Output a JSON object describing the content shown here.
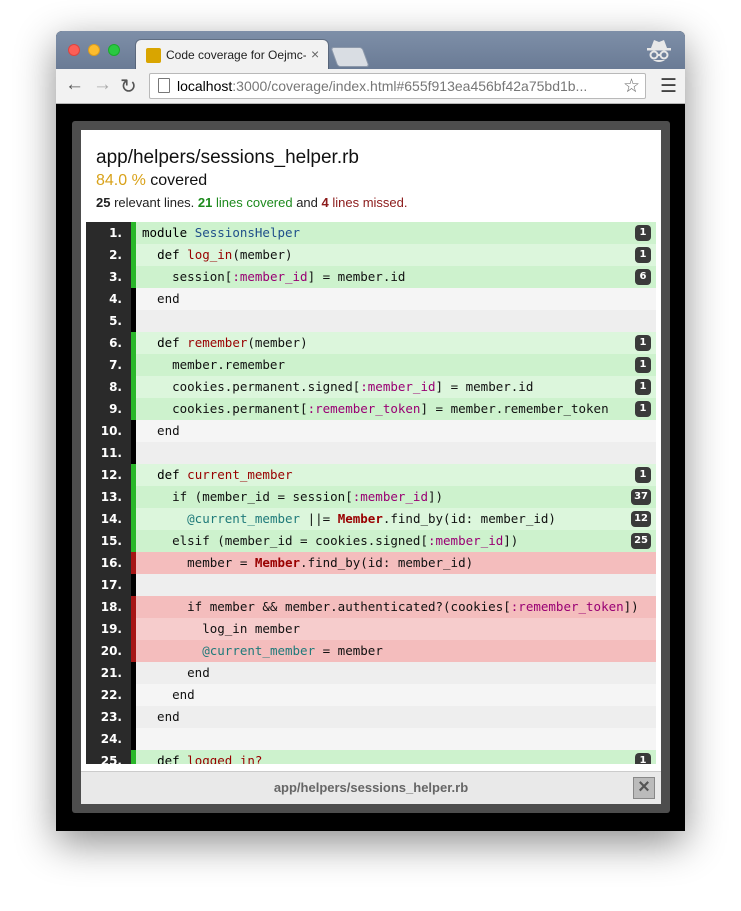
{
  "browser": {
    "tab_title": "Code coverage for Oejmc-",
    "tab_close_icon": "close-icon",
    "url_host": "localhost",
    "url_rest": ":3000/coverage/index.html#655f913ea456bf42a75bd1b..."
  },
  "report": {
    "file_path": "app/helpers/sessions_helper.rb",
    "percent": "84.0 %",
    "covered_word": " covered",
    "relevant_count": "25",
    "relevant_text": " relevant lines. ",
    "covered_count": "21",
    "covered_text": " lines covered",
    "and_text": " and ",
    "missed_count": "4",
    "missed_text": " lines missed."
  },
  "colors": {
    "covered_bar": "#2ab72a",
    "missed_bar": "#a61515",
    "percent": "#d9a21a"
  },
  "lines": [
    {
      "num": "1.",
      "status": "covered",
      "hits": "1",
      "code": [
        [
          "kw",
          "module "
        ],
        [
          "const",
          "SessionsHelper"
        ]
      ]
    },
    {
      "num": "2.",
      "status": "covered",
      "hits": "1",
      "code": [
        [
          "",
          "  "
        ],
        [
          "kw",
          "def "
        ],
        [
          "meth",
          "log_in"
        ],
        [
          "",
          "(member)"
        ]
      ]
    },
    {
      "num": "3.",
      "status": "covered",
      "hits": "6",
      "code": [
        [
          "",
          "    session["
        ],
        [
          "sym",
          ":member_id"
        ],
        [
          "",
          "] = member.id"
        ]
      ]
    },
    {
      "num": "4.",
      "status": "never",
      "hits": "",
      "code": [
        [
          "",
          "  end"
        ]
      ]
    },
    {
      "num": "5.",
      "status": "never",
      "hits": "",
      "code": [
        [
          "",
          ""
        ]
      ]
    },
    {
      "num": "6.",
      "status": "covered",
      "hits": "1",
      "code": [
        [
          "",
          "  "
        ],
        [
          "kw",
          "def "
        ],
        [
          "meth",
          "remember"
        ],
        [
          "",
          "(member)"
        ]
      ]
    },
    {
      "num": "7.",
      "status": "covered",
      "hits": "1",
      "code": [
        [
          "",
          "    member.remember"
        ]
      ]
    },
    {
      "num": "8.",
      "status": "covered",
      "hits": "1",
      "code": [
        [
          "",
          "    cookies.permanent.signed["
        ],
        [
          "sym",
          ":member_id"
        ],
        [
          "",
          "] = member.id"
        ]
      ]
    },
    {
      "num": "9.",
      "status": "covered",
      "hits": "1",
      "code": [
        [
          "",
          "    cookies.permanent["
        ],
        [
          "sym",
          ":remember_token"
        ],
        [
          "",
          "] = member.remember_token"
        ]
      ]
    },
    {
      "num": "10.",
      "status": "never",
      "hits": "",
      "code": [
        [
          "",
          "  end"
        ]
      ]
    },
    {
      "num": "11.",
      "status": "never",
      "hits": "",
      "code": [
        [
          "",
          ""
        ]
      ]
    },
    {
      "num": "12.",
      "status": "covered",
      "hits": "1",
      "code": [
        [
          "",
          "  "
        ],
        [
          "kw",
          "def "
        ],
        [
          "meth",
          "current_member"
        ]
      ]
    },
    {
      "num": "13.",
      "status": "covered",
      "hits": "37",
      "code": [
        [
          "",
          "    if (member_id = session["
        ],
        [
          "sym",
          ":member_id"
        ],
        [
          "",
          "])"
        ]
      ]
    },
    {
      "num": "14.",
      "status": "covered",
      "hits": "12",
      "code": [
        [
          "",
          "      "
        ],
        [
          "ivar",
          "@current_member"
        ],
        [
          "",
          " ||= "
        ],
        [
          "cls",
          "Member"
        ],
        [
          "",
          ".find_by(id: member_id)"
        ]
      ]
    },
    {
      "num": "15.",
      "status": "covered",
      "hits": "25",
      "code": [
        [
          "",
          "    elsif (member_id = cookies.signed["
        ],
        [
          "sym",
          ":member_id"
        ],
        [
          "",
          "])"
        ]
      ]
    },
    {
      "num": "16.",
      "status": "missed",
      "hits": "",
      "code": [
        [
          "",
          "      member = "
        ],
        [
          "cls",
          "Member"
        ],
        [
          "",
          ".find_by(id: member_id)"
        ]
      ]
    },
    {
      "num": "17.",
      "status": "never",
      "hits": "",
      "code": [
        [
          "",
          ""
        ]
      ]
    },
    {
      "num": "18.",
      "status": "missed",
      "hits": "",
      "code": [
        [
          "",
          "      if member && member.authenticated?(cookies["
        ],
        [
          "sym",
          ":remember_token"
        ],
        [
          "",
          "])"
        ]
      ]
    },
    {
      "num": "19.",
      "status": "missed",
      "hits": "",
      "code": [
        [
          "",
          "        log_in member"
        ]
      ]
    },
    {
      "num": "20.",
      "status": "missed",
      "hits": "",
      "code": [
        [
          "",
          "        "
        ],
        [
          "ivar",
          "@current_member"
        ],
        [
          "",
          " = member"
        ]
      ]
    },
    {
      "num": "21.",
      "status": "never",
      "hits": "",
      "code": [
        [
          "",
          "      end"
        ]
      ]
    },
    {
      "num": "22.",
      "status": "never",
      "hits": "",
      "code": [
        [
          "",
          "    end"
        ]
      ]
    },
    {
      "num": "23.",
      "status": "never",
      "hits": "",
      "code": [
        [
          "",
          "  end"
        ]
      ]
    },
    {
      "num": "24.",
      "status": "never",
      "hits": "",
      "code": [
        [
          "",
          ""
        ]
      ]
    },
    {
      "num": "25.",
      "status": "covered",
      "hits": "1",
      "code": [
        [
          "",
          "  "
        ],
        [
          "kw",
          "def "
        ],
        [
          "meth",
          "logged_in?"
        ]
      ]
    }
  ],
  "footer": {
    "title": "app/helpers/sessions_helper.rb",
    "close_icon": "close-icon"
  }
}
